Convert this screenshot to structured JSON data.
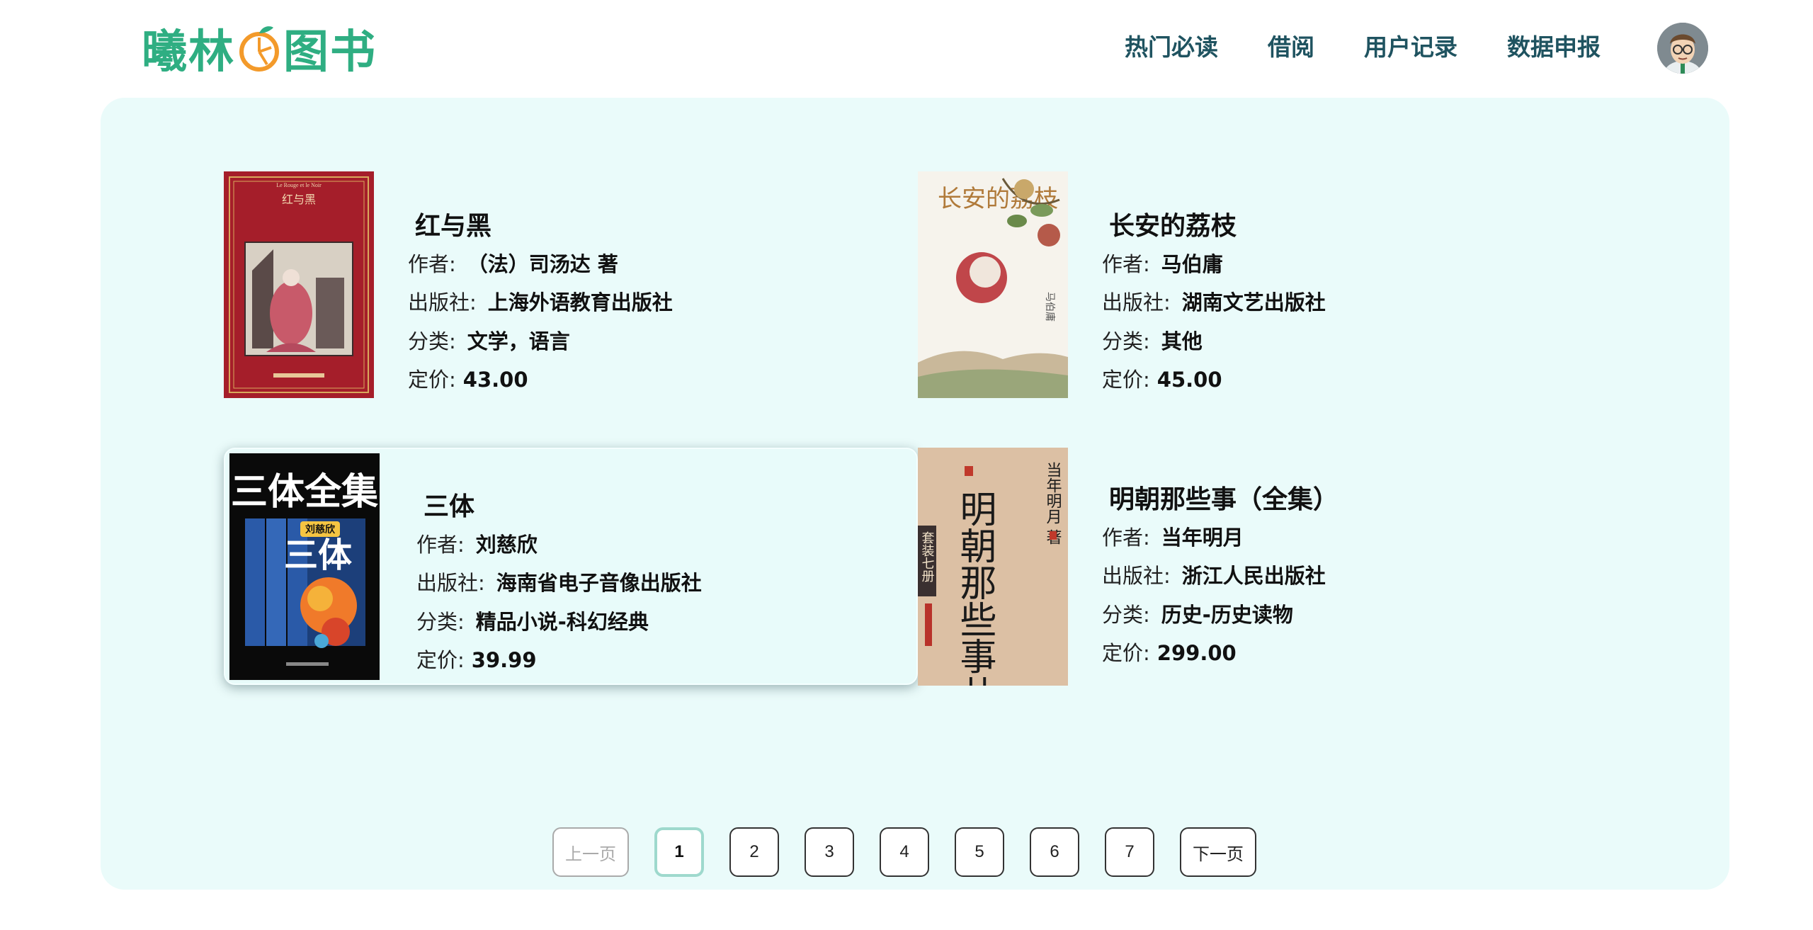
{
  "header": {
    "logo_left": "曦林",
    "logo_right": "图书",
    "nav": [
      "热门必读",
      "借阅",
      "用户记录",
      "数据申报"
    ]
  },
  "labels": {
    "author": "作者:",
    "publisher": "出版社:",
    "category": "分类:",
    "price": "定价:"
  },
  "books": [
    {
      "title": "红与黑",
      "author": "（法）司汤达 著",
      "publisher": "上海外语教育出版社",
      "category": "文学，语言",
      "price": "43.00"
    },
    {
      "title": "长安的荔枝",
      "author": "马伯庸",
      "publisher": "湖南文艺出版社",
      "category": "其他",
      "price": "45.00"
    },
    {
      "title": "三体",
      "author": "刘慈欣",
      "publisher": "海南省电子音像出版社",
      "category": "精品小说-科幻经典",
      "price": "39.99"
    },
    {
      "title": "明朝那些事（全集）",
      "author": "当年明月",
      "publisher": "浙江人民出版社",
      "category": "历史-历史读物",
      "price": "299.00"
    }
  ],
  "covers": {
    "hongyuhei": {
      "top_text": "Le Rouge et le Noir",
      "title": "红与黑"
    },
    "changan": {
      "title": "长安的荔枝",
      "author": "马伯庸"
    },
    "santi": {
      "banner": "三体全集",
      "author": "刘慈欣",
      "title": "三体"
    },
    "mingchao": {
      "title": "明朝那些事儿",
      "author": "当年明月 著",
      "tag": "套装七册"
    }
  },
  "pagination": {
    "prev": "上一页",
    "next": "下一页",
    "pages": [
      "1",
      "2",
      "3",
      "4",
      "5",
      "6",
      "7"
    ],
    "current": "1"
  },
  "colors": {
    "brand_green": "#2fae82",
    "nav_text": "#1f5360",
    "panel_bg": "#eafbfa",
    "current_page_border": "#9ed9cd"
  }
}
